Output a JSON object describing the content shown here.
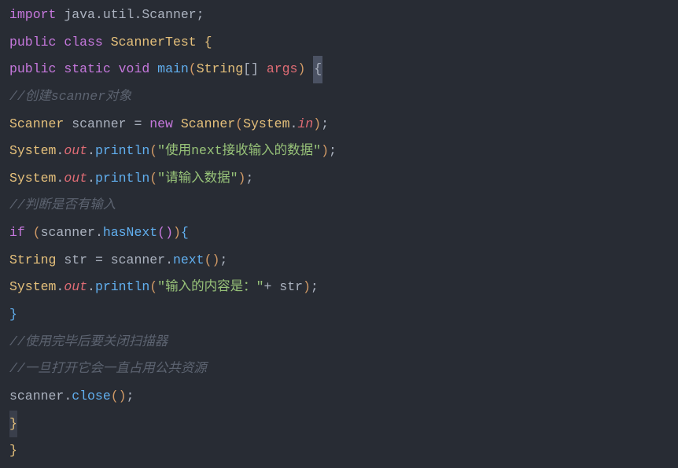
{
  "code": {
    "line1": {
      "import": "import",
      "pkg": " java.util.Scanner",
      "semi": ";"
    },
    "line3": {
      "public": "public",
      "class": "class",
      "name": "ScannerTest",
      "brace": "{"
    },
    "line4": {
      "public": "public",
      "static": "static",
      "void": "void",
      "main": "main",
      "lparen": "(",
      "string": "String",
      "brackets": "[]",
      "args": " args",
      "rparen": ")",
      "brace": "{"
    },
    "line5": {
      "comment": "//创建scanner对象"
    },
    "line6": {
      "type1": "Scanner",
      "var": " scanner ",
      "eq": "=",
      "new": " new ",
      "type2": "Scanner",
      "lparen": "(",
      "system": "System",
      "dot": ".",
      "in": "in",
      "rparen": ")",
      "semi": ";"
    },
    "line7": {
      "system": "System",
      "dot1": ".",
      "out": "out",
      "dot2": ".",
      "println": "println",
      "lparen": "(",
      "str": "\"使用next接收输入的数据\"",
      "rparen": ")",
      "semi": ";"
    },
    "line8": {
      "system": "System",
      "dot1": ".",
      "out": "out",
      "dot2": ".",
      "println": "println",
      "lparen": "(",
      "str": "\"请输入数据\"",
      "rparen": ")",
      "semi": ";"
    },
    "line9": {
      "comment": "//判断是否有输入"
    },
    "line10": {
      "if": "if",
      "sp": " ",
      "lparen": "(",
      "scanner": "scanner",
      "dot": ".",
      "hasNext": "hasNext",
      "lparen2": "(",
      "rparen2": ")",
      "rparen": ")",
      "brace": "{"
    },
    "line11": {
      "type": "String",
      "var": " str ",
      "eq": "=",
      "sp": " ",
      "scanner": "scanner",
      "dot": ".",
      "next": "next",
      "lparen": "(",
      "rparen": ")",
      "semi": ";"
    },
    "line12": {
      "system": "System",
      "dot1": ".",
      "out": "out",
      "dot2": ".",
      "println": "println",
      "lparen": "(",
      "str": "\"输入的内容是：\"",
      "plus": "+",
      "var": " str",
      "rparen": ")",
      "semi": ";"
    },
    "line13": {
      "brace": "}"
    },
    "line14": {
      "comment": "//使用完毕后要关闭扫描器"
    },
    "line15": {
      "comment": "//一旦打开它会一直占用公共资源"
    },
    "line16": {
      "scanner": "scanner",
      "dot": ".",
      "close": "close",
      "lparen": "(",
      "rparen": ")",
      "semi": ";"
    },
    "line17": {
      "brace": "}"
    },
    "line18": {
      "brace": "}"
    }
  }
}
